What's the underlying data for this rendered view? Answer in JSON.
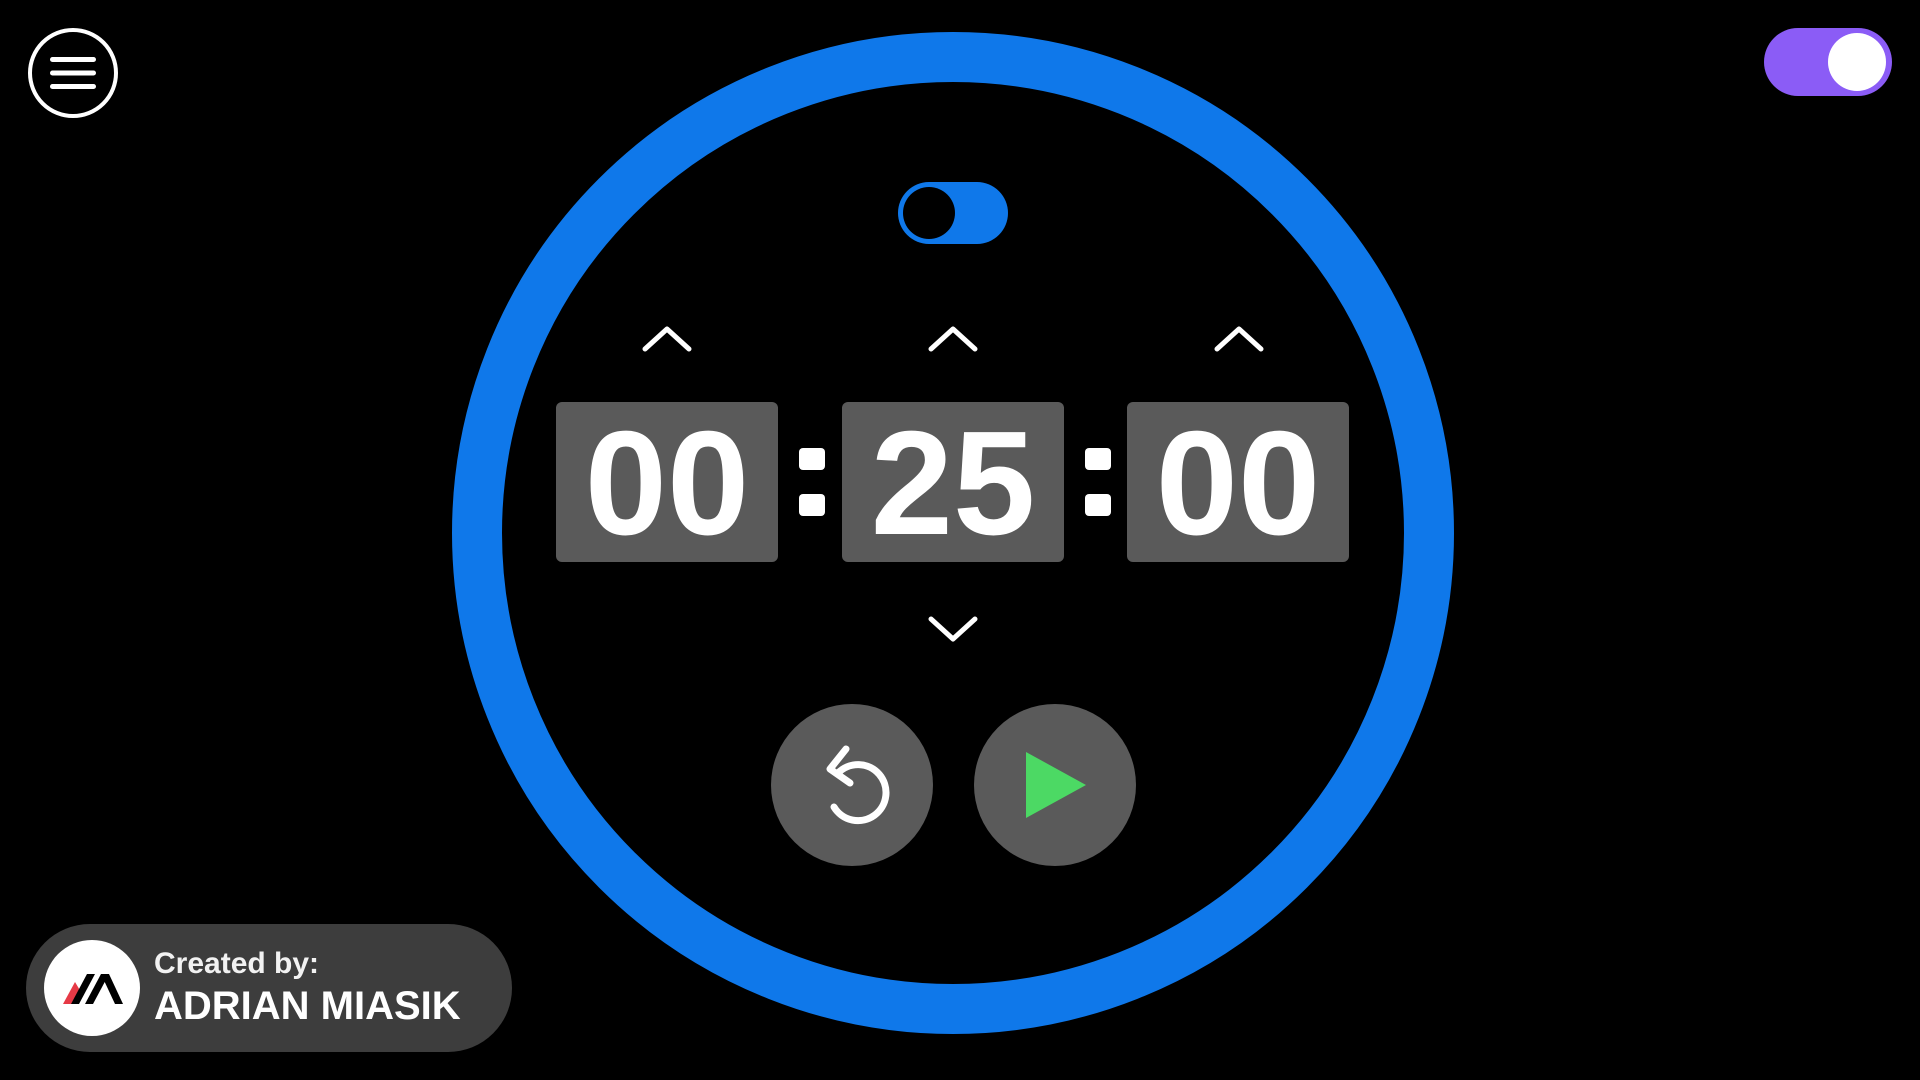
{
  "header": {
    "menu_icon": "hamburger-menu-icon",
    "theme_toggle": {
      "state": "on",
      "color": "#8b5cf6"
    }
  },
  "timer": {
    "ring_color": "#0f78ea",
    "mode_toggle": {
      "state": "off"
    },
    "hours": "00",
    "minutes": "25",
    "seconds": "00",
    "separator": ":",
    "controls": {
      "reset_icon": "reset-icon",
      "play_icon": "play-icon",
      "play_color": "#4cd964"
    }
  },
  "credit": {
    "label": "Created by:",
    "name": "ADRIAN MIASIK",
    "logo_icon": "am-logo-icon"
  }
}
